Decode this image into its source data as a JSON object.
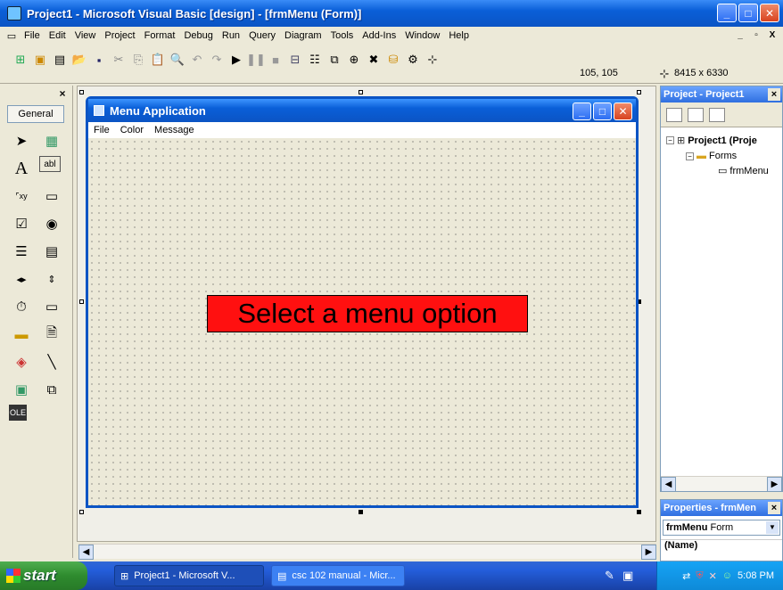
{
  "window": {
    "title": "Project1 - Microsoft Visual Basic [design] - [frmMenu (Form)]",
    "minimize": "_",
    "maximize": "□",
    "close": "✕"
  },
  "menubar": {
    "items": [
      "File",
      "Edit",
      "View",
      "Project",
      "Format",
      "Debug",
      "Run",
      "Query",
      "Diagram",
      "Tools",
      "Add-Ins",
      "Window",
      "Help"
    ],
    "mdi_min": "_",
    "mdi_restore": "▫",
    "mdi_close": "X"
  },
  "toolbar": {
    "position": "105, 105",
    "size": "8415 x 6330"
  },
  "toolbox": {
    "close": "×",
    "tab_label": "General",
    "tools": [
      "pointer-icon",
      "picturebox-icon",
      "label-icon",
      "textbox-icon",
      "frame-icon",
      "commandbutton-icon",
      "checkbox-icon",
      "optionbutton-icon",
      "combobox-icon",
      "listbox-icon",
      "hscrollbar-icon",
      "vscrollbar-icon",
      "timer-icon",
      "drivelistbox-icon",
      "dirlistbox-icon",
      "filelistbox-icon",
      "shape-icon",
      "line-icon",
      "image-icon",
      "data-icon",
      "ole-icon"
    ]
  },
  "form": {
    "caption": "Menu Application",
    "menus": [
      "File",
      "Color",
      "Message"
    ],
    "label_text": "Select a menu option",
    "label_bg": "#ff1010"
  },
  "project_explorer": {
    "title": "Project - Project1",
    "close": "×",
    "tree": {
      "project": "Project1 (Proje",
      "folder": "Forms",
      "form": "frmMenu"
    }
  },
  "properties": {
    "title": "Properties - frmMen",
    "close": "×",
    "object": "frmMenu",
    "object_type": "Form",
    "first_prop": "(Name)"
  },
  "taskbar": {
    "start_label": "start",
    "items": [
      "Project1 - Microsoft V...",
      "csc 102 manual - Micr..."
    ],
    "clock": "5:08 PM"
  }
}
